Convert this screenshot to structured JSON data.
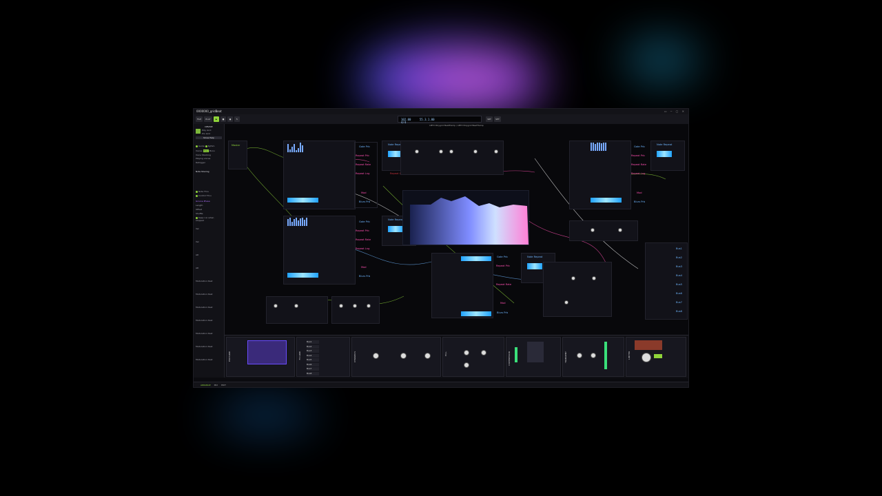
{
  "app": {
    "tab_title": "0000000_gridBeat",
    "tab_close": "×",
    "window_controls": "▭ ─ ▢ ✕"
  },
  "toolbar": {
    "file_label": "FILE",
    "play_label": "PLAY",
    "transport": {
      "tempo": "102.00",
      "position": "55.3.1.00",
      "signature": "4/4",
      "time": "0:33.855"
    },
    "transport_btns": [
      "SRT",
      "SET"
    ]
  },
  "sidebar": {
    "section_device": "DEVICE",
    "device_name": "Poly Grid",
    "device_type": "Pro Grid",
    "show_help": "Show Help",
    "guide_label": "Guide",
    "rythm_label": "Rythm",
    "voices_label": "Voices",
    "voices_opts": [
      "Poly",
      "Mono"
    ],
    "voice_stacking": "Voice Stacking",
    "playing_voices": "Playing voices",
    "retrigger_label": "Retrigger",
    "note_sharing": "Note Sharing",
    "note_thru": "Note Thru",
    "control_thru": "Control Thru",
    "groove_label": "Groove Phase",
    "length_label": "Length",
    "offset_label": "Offset",
    "shuffle_label": "Shuffle",
    "keep_label": "Keep run when stopped",
    "mod_rows": [
      "Vel",
      "Vel",
      "AD",
      "AD",
      "Modulation Dest",
      "Modulation Dest",
      "Modulation Dest",
      "Modulation Dest",
      "Modulation Dest",
      "Modulation Dest",
      "Modulation Dest"
    ]
  },
  "canvas": {
    "breadcrumb": "LBTX Polygrid BeatTramp / LBTX Polygrid BeatTramp",
    "master_label": "Master",
    "group_labels": [
      "Gate Prb",
      "Repeat Prb",
      "Repeat Rate",
      "Repeat Lng",
      "Mod",
      "Blurs Prb"
    ],
    "note_repeat": "Note Repeat",
    "bus_labels": [
      "Bus1",
      "Bus2",
      "Bus3",
      "Bus4",
      "Bus5",
      "Bus6",
      "Bus7",
      "Bus8"
    ]
  },
  "devices": [
    "POLYGRID",
    "LBTX POLYGRID BEATTRAMP",
    "FX GRID",
    "",
    "",
    "DYNAMICS",
    "EQ+",
    "COMPRESSOR",
    "TRANSIENT",
    "STEREO",
    "LIMITER"
  ],
  "status": {
    "arrange": "ARRANGE",
    "mix": "MIX",
    "edit": "EDIT"
  },
  "colors": {
    "accent": "#8fd43a",
    "blue": "#6fb6ff",
    "pink": "#ff4fb0",
    "cyan": "#3fc5ff"
  }
}
